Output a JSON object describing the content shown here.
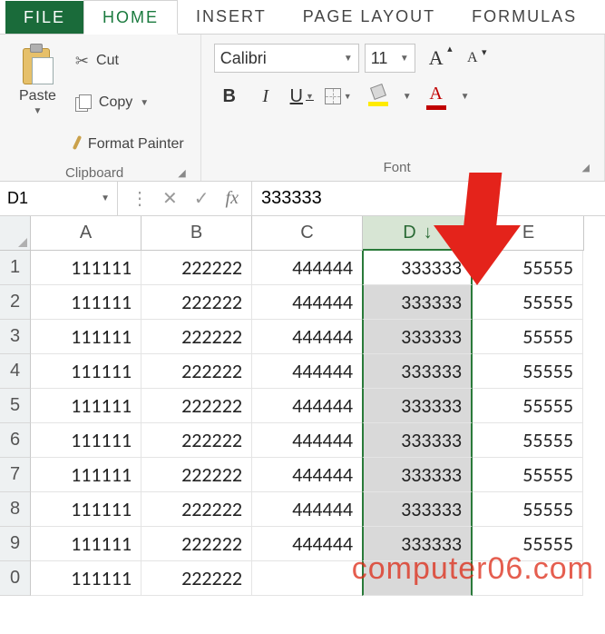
{
  "tabs": {
    "file": "FILE",
    "home": "HOME",
    "insert": "INSERT",
    "page_layout": "PAGE LAYOUT",
    "formulas": "FORMULAS"
  },
  "clipboard": {
    "paste": "Paste",
    "cut": "Cut",
    "copy": "Copy",
    "format_painter": "Format Painter",
    "group_title": "Clipboard"
  },
  "font": {
    "name": "Calibri",
    "size": "11",
    "bold": "B",
    "italic": "I",
    "underline": "U",
    "fontcolor_letter": "A",
    "grow_letter": "A",
    "shrink_letter": "A",
    "group_title": "Font"
  },
  "formula_bar": {
    "name_box": "D1",
    "fx": "fx",
    "value": "333333"
  },
  "columns": [
    "A",
    "B",
    "C",
    "D",
    "E"
  ],
  "selected_col_arrow": "↓",
  "rows": [
    {
      "n": "1",
      "A": "111111",
      "B": "222222",
      "C": "444444",
      "D": "333333",
      "E": "55555"
    },
    {
      "n": "2",
      "A": "111111",
      "B": "222222",
      "C": "444444",
      "D": "333333",
      "E": "55555"
    },
    {
      "n": "3",
      "A": "111111",
      "B": "222222",
      "C": "444444",
      "D": "333333",
      "E": "55555"
    },
    {
      "n": "4",
      "A": "111111",
      "B": "222222",
      "C": "444444",
      "D": "333333",
      "E": "55555"
    },
    {
      "n": "5",
      "A": "111111",
      "B": "222222",
      "C": "444444",
      "D": "333333",
      "E": "55555"
    },
    {
      "n": "6",
      "A": "111111",
      "B": "222222",
      "C": "444444",
      "D": "333333",
      "E": "55555"
    },
    {
      "n": "7",
      "A": "111111",
      "B": "222222",
      "C": "444444",
      "D": "333333",
      "E": "55555"
    },
    {
      "n": "8",
      "A": "111111",
      "B": "222222",
      "C": "444444",
      "D": "333333",
      "E": "55555"
    },
    {
      "n": "9",
      "A": "111111",
      "B": "222222",
      "C": "444444",
      "D": "333333",
      "E": "55555"
    },
    {
      "n": "0",
      "A": "111111",
      "B": "222222",
      "C": "",
      "D": "",
      "E": ""
    }
  ],
  "watermark": "computer06.com"
}
